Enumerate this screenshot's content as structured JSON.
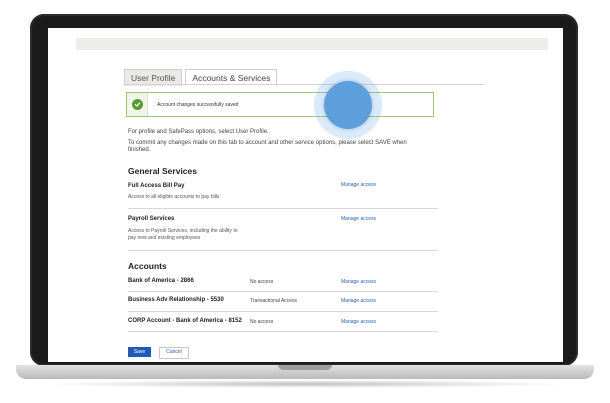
{
  "tabs": [
    {
      "label": "User Profile",
      "active": false
    },
    {
      "label": "Accounts & Services",
      "active": true
    }
  ],
  "alert": {
    "message": "Account changes successfully saved",
    "color": "#5a9b2f"
  },
  "info": {
    "line1": "For profile and SafePass options, select User Profile.",
    "line2": "To commit any changes made on this tab to account and other service options, please select SAVE when",
    "line3": "finished."
  },
  "general_services": {
    "title": "General Services",
    "items": [
      {
        "label": "Full Access Bill Pay",
        "desc_lines": [
          "Access to all eligible accounts to pay bills"
        ],
        "link": "Manage access"
      },
      {
        "label": "Payroll Services",
        "desc_lines": [
          "Access to Payroll Services, including the ability to",
          "pay new and existing employees"
        ],
        "link": "Manage access"
      }
    ]
  },
  "accounts": {
    "title": "Accounts",
    "items": [
      {
        "name": "Bank of America - 2866",
        "status": "No access",
        "link": "Manage access"
      },
      {
        "name": "Business Adv Relationship - 5530",
        "status": "Transactional Access",
        "link": "Manage access"
      },
      {
        "name": "CORP Account - Bank of America - 8152",
        "status": "No access",
        "link": "Manage access"
      }
    ]
  },
  "buttons": {
    "save": "Save",
    "cancel": "Cancel"
  },
  "colors": {
    "primary": "#1f5bb4",
    "link": "#2560b8",
    "success_border": "#9cc86e"
  }
}
